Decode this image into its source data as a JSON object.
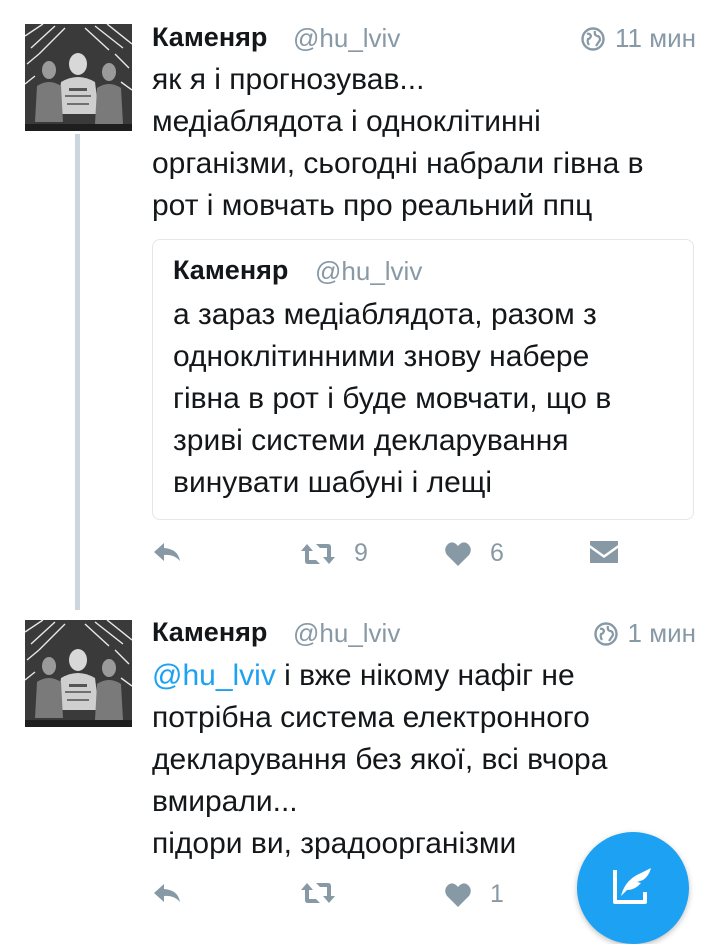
{
  "tweets": [
    {
      "author_name": "Каменяр",
      "author_handle": "@hu_lviv",
      "time": "11 мин",
      "text": "як я і прогнозував...\nмедіаблядота і одноклітинні\nорганізми, сьогодні набрали гівна в\nрот і мовчать про реальний ппц",
      "quote": {
        "author_name": "Каменяр",
        "author_handle": "@hu_lviv",
        "text": "а зараз медіаблядота, разом з\nодноклітинними знову набере\nгівна в рот і буде мовчати, що в\nзриві системи декларування\nвинувати шабуні і лещі"
      },
      "retweet_count": "9",
      "like_count": "6"
    },
    {
      "author_name": "Каменяр",
      "author_handle": "@hu_lviv",
      "time": "1 мин",
      "text_mention": "@hu_lviv",
      "text": " і вже нікому нафіг не\nпотрібна система електронного\nдекларування без якої, всі вчора\nвмирали...\nпідори ви, зрадоорганізми",
      "like_count": "1"
    }
  ],
  "icons": {
    "reply": "reply-icon",
    "retweet": "retweet-icon",
    "like": "heart-icon",
    "dm": "direct-message-icon",
    "globe": "globe-icon",
    "compose": "compose-tweet-icon"
  },
  "colors": {
    "accent": "#1da1f2",
    "muted": "#8899a6",
    "text": "#14171a",
    "thread_line": "#ccd6dd"
  }
}
